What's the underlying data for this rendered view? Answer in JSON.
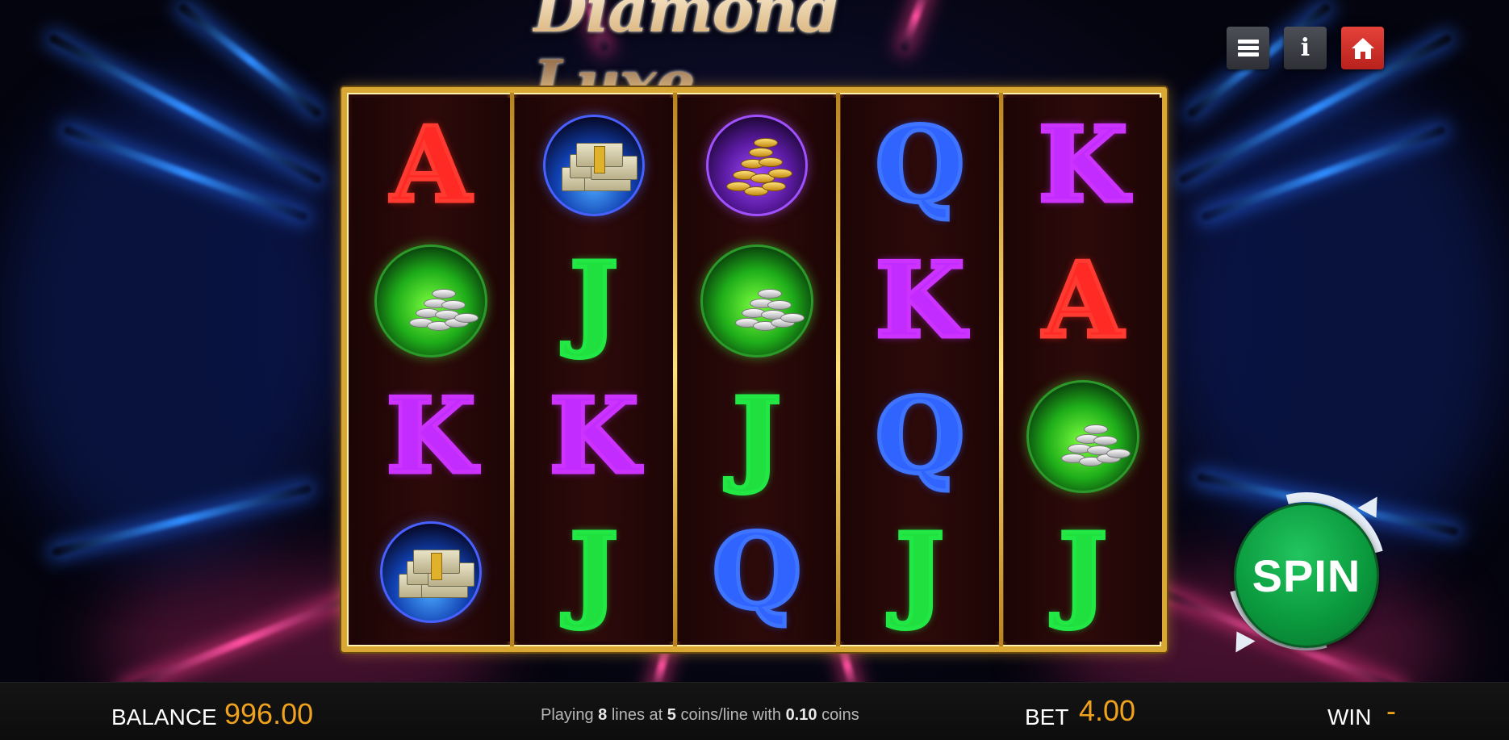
{
  "game": {
    "title": "Diamond Luxe"
  },
  "header_buttons": [
    {
      "name": "menu-button",
      "icon": "hamburger-menu-icon"
    },
    {
      "name": "info-button",
      "icon": "info-icon",
      "glyph": "i"
    },
    {
      "name": "home-button",
      "icon": "home-icon"
    }
  ],
  "reels": [
    [
      "A",
      "silver-coins",
      "K",
      "cash-stack"
    ],
    [
      "cash-stack",
      "J",
      "K",
      "J"
    ],
    [
      "gold-coins",
      "silver-coins",
      "J",
      "Q"
    ],
    [
      "Q",
      "K",
      "Q",
      "J"
    ],
    [
      "K",
      "A",
      "silver-coins",
      "J"
    ]
  ],
  "spin": {
    "label": "SPIN"
  },
  "status": {
    "balance_label": "BALANCE",
    "balance_value": "996.00",
    "lines_prefix": "Playing",
    "lines_count": "8",
    "lines_mid1": "lines at",
    "coins_per_line": "5",
    "lines_mid2": "coins/line with",
    "coin_value": "0.10",
    "lines_suffix": "coins",
    "bet_label": "BET",
    "bet_value": "4.00",
    "win_label": "WIN",
    "win_value": "-"
  },
  "colors": {
    "frame_gold": "#d9a733",
    "spin_green": "#0b9a3e",
    "value_orange": "#f0a21e",
    "home_red": "#d6322c"
  }
}
